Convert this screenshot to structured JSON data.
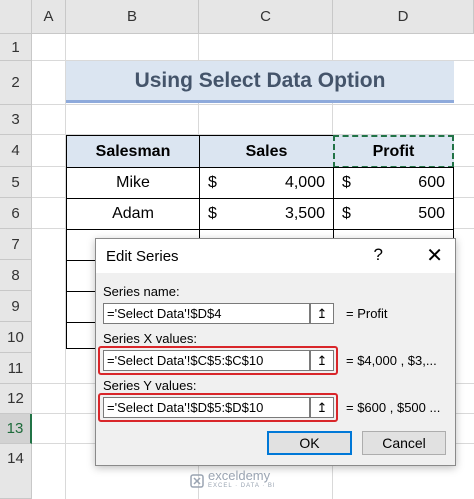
{
  "sheet": {
    "columns": [
      "A",
      "B",
      "C",
      "D"
    ],
    "rows": [
      "1",
      "2",
      "3",
      "4",
      "5",
      "6",
      "7",
      "8",
      "9",
      "10",
      "11",
      "12",
      "13",
      "14"
    ],
    "selected_row": "13",
    "title": "Using Select Data Option",
    "table": {
      "headers": [
        "Salesman",
        "Sales",
        "Profit"
      ],
      "rows": [
        {
          "salesman": "Mike",
          "sales_cur": "$",
          "sales": "4,000",
          "profit_cur": "$",
          "profit": "600"
        },
        {
          "salesman": "Adam",
          "sales_cur": "$",
          "sales": "3,500",
          "profit_cur": "$",
          "profit": "500"
        }
      ]
    }
  },
  "dialog": {
    "title": "Edit Series",
    "help_label": "?",
    "close_label": "✕",
    "series_name_label": "Series name:",
    "series_name_value": "='Select Data'!$D$4",
    "series_name_preview": "= Profit",
    "x_label": "Series X values:",
    "x_value": "='Select Data'!$C$5:$C$10",
    "x_preview": "= $4,000 , $3,...",
    "y_label": "Series Y values:",
    "y_value": "='Select Data'!$D$5:$D$10",
    "y_preview": "= $600 , $500 ...",
    "collapse_icon": "↥",
    "ok_label": "OK",
    "cancel_label": "Cancel"
  },
  "watermark": {
    "brand": "exceldemy",
    "tagline": "EXCEL · DATA · BI"
  },
  "colors": {
    "header_fill": "#dbe5f1",
    "title_text": "#44546a",
    "highlight_red": "#d9262a",
    "excel_green": "#217346",
    "ok_border": "#0078d7"
  }
}
